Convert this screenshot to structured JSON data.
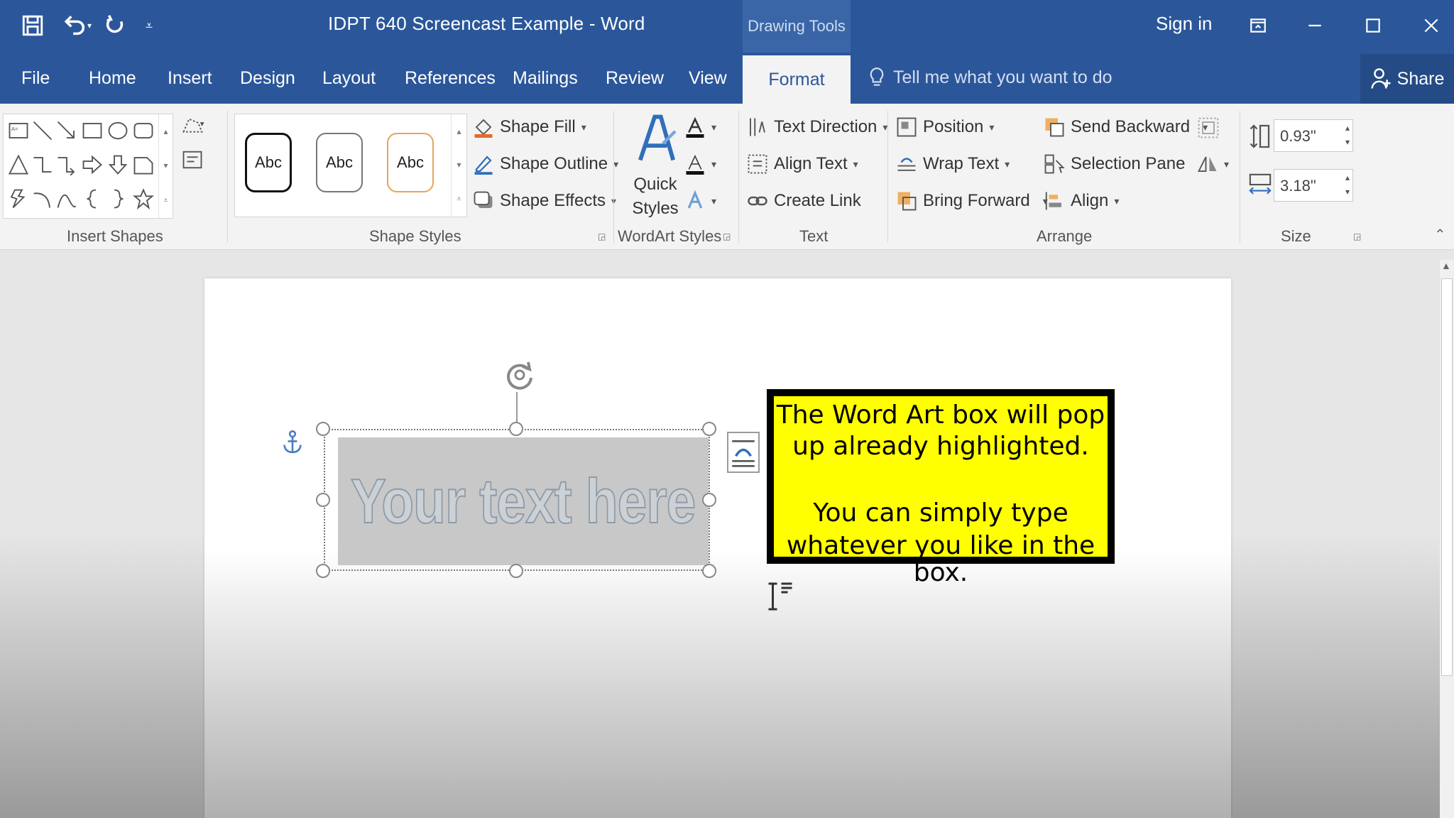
{
  "titlebar": {
    "doc_title": "IDPT 640 Screencast Example  -  Word",
    "context_tab_group": "Drawing Tools",
    "sign_in": "Sign in"
  },
  "tabs": {
    "items": [
      "File",
      "Home",
      "Insert",
      "Design",
      "Layout",
      "References",
      "Mailings",
      "Review",
      "View"
    ],
    "active": "Format",
    "tell_me": "Tell me what you want to do",
    "share": "Share"
  },
  "ribbon": {
    "groups": {
      "insert_shapes": "Insert Shapes",
      "shape_styles": "Shape Styles",
      "wordart_styles": "WordArt Styles",
      "text": "Text",
      "arrange": "Arrange",
      "size": "Size"
    },
    "shape_style_samples": [
      "Abc",
      "Abc",
      "Abc"
    ],
    "shape_fill": "Shape Fill",
    "shape_outline": "Shape Outline",
    "shape_effects": "Shape Effects",
    "quick_styles_1": "Quick",
    "quick_styles_2": "Styles",
    "text_direction": "Text Direction",
    "align_text": "Align Text",
    "create_link": "Create Link",
    "position": "Position",
    "wrap_text": "Wrap Text",
    "bring_forward": "Bring Forward",
    "send_backward": "Send Backward",
    "selection_pane": "Selection Pane",
    "align": "Align",
    "height": "0.93\"",
    "width": "3.18\""
  },
  "document": {
    "wordart_text": "Your text here"
  },
  "callout": {
    "line1": "The Word Art box will pop",
    "line2": "up already highlighted.",
    "line3": "You can simply type",
    "line4": "whatever you like in the",
    "line5": "box."
  },
  "colors": {
    "word_blue": "#2b579a",
    "callout_yellow": "#ffff00"
  }
}
